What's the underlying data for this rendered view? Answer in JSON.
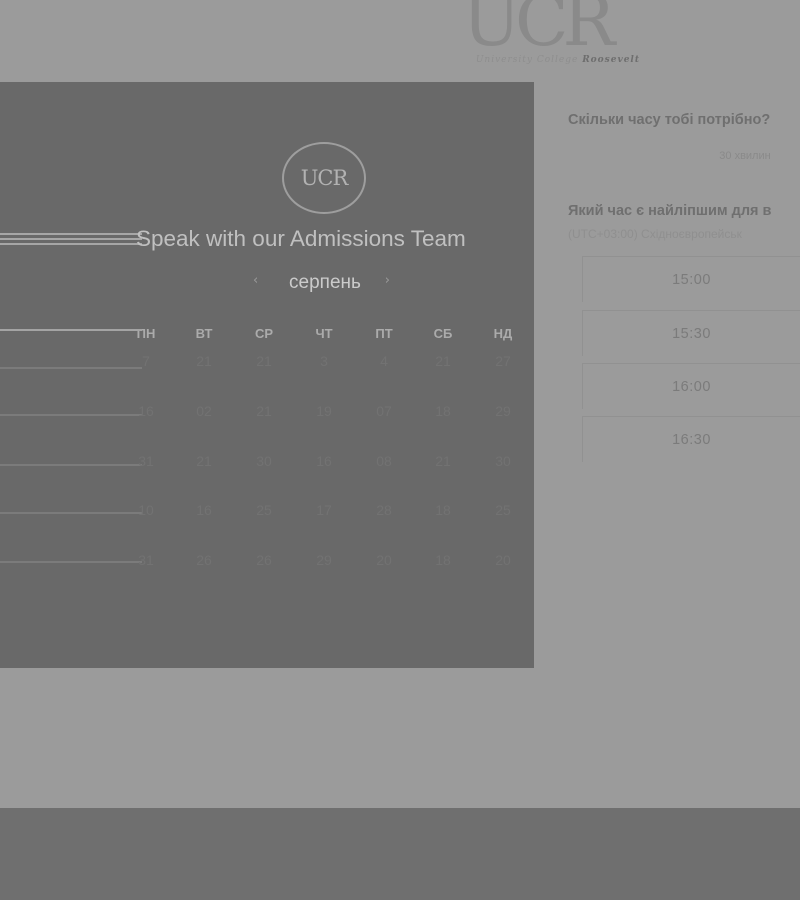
{
  "logo": {
    "mark": "UCR",
    "subtitle_a": "University College ",
    "subtitle_b": "Roosevelt"
  },
  "booking": {
    "title": "Speak with our Admissions Team",
    "logo_text": "UCR",
    "month": "серпень",
    "prev_icon": "chevron-left-icon",
    "next_icon": "chevron-right-icon",
    "weekdays": [
      "ПН",
      "ВТ",
      "СР",
      "ЧТ",
      "ПТ",
      "СБ",
      "НД"
    ],
    "weeks": [
      [
        "7",
        "21",
        "21",
        "3",
        "4",
        "21",
        "27"
      ],
      [
        "16",
        "02",
        "21",
        "19",
        "07",
        "18",
        "29"
      ],
      [
        "31",
        "21",
        "30",
        "16",
        "08",
        "21",
        "30"
      ],
      [
        "10",
        "16",
        "25",
        "17",
        "28",
        "18",
        "25"
      ],
      [
        "31",
        "26",
        "26",
        "29",
        "20",
        "18",
        "20"
      ]
    ]
  },
  "sidebar": {
    "duration_question": "Скільки часу тобі потрібно?",
    "duration_value": "30 хвилин",
    "time_question": "Який час є найліпшим для в",
    "timezone": "(UTC+03:00) Східноєвропейськ",
    "slots": [
      "15:00",
      "15:30",
      "16:00",
      "16:30"
    ]
  },
  "colors": {
    "overlay": "#9b9b9b",
    "panel": "#696969",
    "footer": "#6f6f6f"
  }
}
